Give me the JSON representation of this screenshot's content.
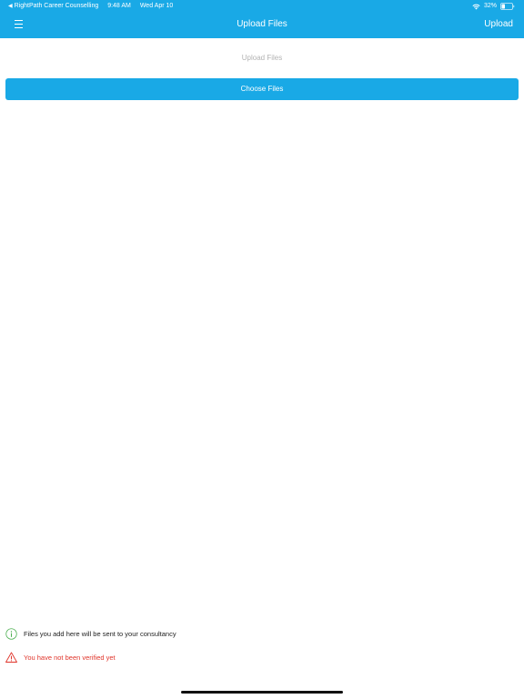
{
  "status_bar": {
    "back_app": "RightPath Career Counselling",
    "time": "9:48 AM",
    "date": "Wed Apr 10",
    "battery": "32%"
  },
  "nav": {
    "title": "Upload Files",
    "action_label": "Upload"
  },
  "main": {
    "section_label": "Upload Files",
    "choose_button_label": "Choose Files"
  },
  "notices": {
    "info_text": "Files you add here will be sent to your consultancy",
    "warning_text": "You have not been verified yet"
  },
  "colors": {
    "accent": "#19a9e6",
    "warning": "#e0352b",
    "info_icon": "#4caf50"
  }
}
